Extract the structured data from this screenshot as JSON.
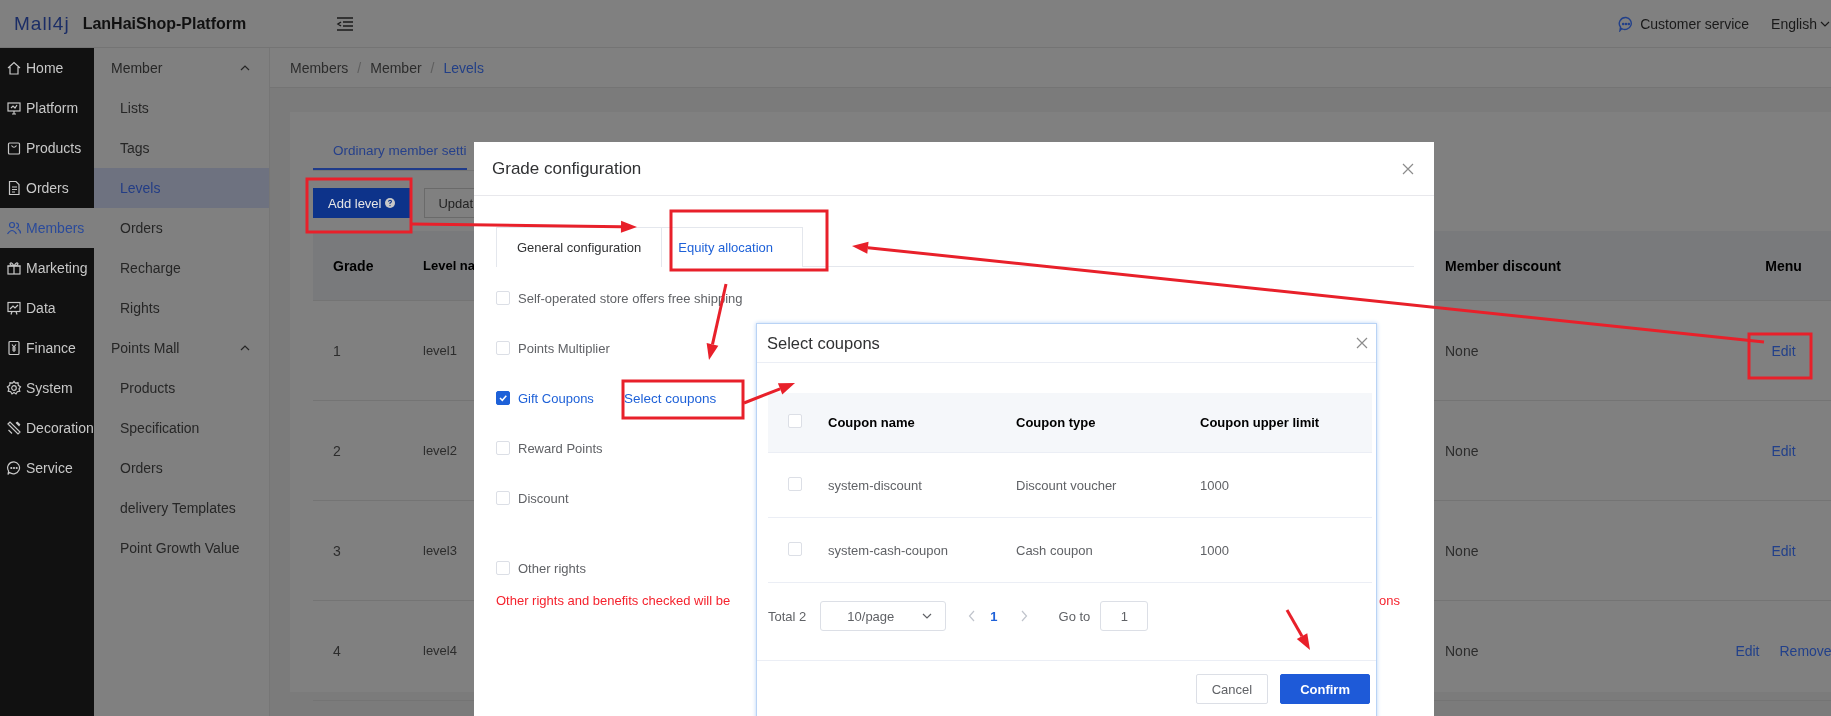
{
  "header": {
    "logo": "Mall4j",
    "title": "LanHaiShop-Platform",
    "customer_service": "Customer service",
    "language": "English"
  },
  "sidebar": {
    "items": [
      {
        "label": "Home",
        "selected": false
      },
      {
        "label": "Platform",
        "selected": false
      },
      {
        "label": "Products",
        "selected": false
      },
      {
        "label": "Orders",
        "selected": false
      },
      {
        "label": "Members",
        "selected": true
      },
      {
        "label": "Marketing",
        "selected": false
      },
      {
        "label": "Data",
        "selected": false
      },
      {
        "label": "Finance",
        "selected": false
      },
      {
        "label": "System",
        "selected": false
      },
      {
        "label": "Decoration",
        "selected": false
      },
      {
        "label": "Service",
        "selected": false
      }
    ]
  },
  "subnav": {
    "groups": [
      {
        "label": "Member",
        "expanded": true,
        "items": [
          {
            "label": "Lists",
            "selected": false
          },
          {
            "label": "Tags",
            "selected": false
          },
          {
            "label": "Levels",
            "selected": true
          },
          {
            "label": "Orders",
            "selected": false
          },
          {
            "label": "Recharge",
            "selected": false
          },
          {
            "label": "Rights",
            "selected": false
          }
        ]
      },
      {
        "label": "Points Mall",
        "expanded": true,
        "items": [
          {
            "label": "Products",
            "selected": false
          },
          {
            "label": "Specification",
            "selected": false
          },
          {
            "label": "Orders",
            "selected": false
          },
          {
            "label": "delivery Templates",
            "selected": false
          },
          {
            "label": "Point Growth Value",
            "selected": false
          }
        ]
      }
    ]
  },
  "breadcrumb": [
    {
      "label": "Members",
      "separator": "/"
    },
    {
      "label": "Member",
      "separator": "/"
    },
    {
      "label": "Levels"
    }
  ],
  "page": {
    "tabs": [
      {
        "label": "Ordinary member setti",
        "selected": true
      }
    ],
    "buttons": [
      {
        "label": "Add level",
        "kind": "primary"
      },
      {
        "label": "Updat",
        "kind": "default"
      }
    ],
    "table": {
      "columns": [
        "Grade",
        "Level na",
        "Member discount",
        "Menu"
      ],
      "rows": [
        {
          "grade": "1",
          "level_name": "level1",
          "member_discount": "None",
          "menu": [
            "Edit"
          ]
        },
        {
          "grade": "2",
          "level_name": "level2",
          "member_discount": "None",
          "menu": [
            "Edit"
          ]
        },
        {
          "grade": "3",
          "level_name": "level3",
          "member_discount": "None",
          "menu": [
            "Edit"
          ]
        },
        {
          "grade": "4",
          "level_name": "level4",
          "member_discount": "None",
          "menu": [
            "Edit",
            "Remove"
          ]
        }
      ]
    }
  },
  "grade_dialog": {
    "title": "Grade configuration",
    "tabs": [
      {
        "label": "General configuration",
        "selected": false
      },
      {
        "label": "Equity allocation",
        "selected": true
      }
    ],
    "rights": [
      {
        "label": "Self-operated store offers free shipping",
        "checked": false
      },
      {
        "label": "Points Multiplier",
        "checked": false
      },
      {
        "label": "Gift Coupons",
        "checked": true,
        "link": "Select coupons"
      },
      {
        "label": "Reward Points",
        "checked": false
      },
      {
        "label": "Discount",
        "checked": false
      },
      {
        "label": "Other rights",
        "checked": false
      }
    ],
    "note": "Other rights and benefits checked will be",
    "note_tail": "ons"
  },
  "coupon_dialog": {
    "title": "Select coupons",
    "header_checked": false,
    "columns": [
      "Coupon name",
      "Coupon type",
      "Coupon upper limit"
    ],
    "rows": [
      {
        "checked": false,
        "cells": [
          "system-discount",
          "Discount voucher",
          "1000"
        ]
      },
      {
        "checked": false,
        "cells": [
          "system-cash-coupon",
          "Cash coupon",
          "1000"
        ]
      }
    ],
    "pagination": {
      "total": "Total 2",
      "page_size": "10/page",
      "pages": [
        {
          "label": "1",
          "selected": true
        }
      ],
      "goto_label": "Go to",
      "goto_value": "1"
    },
    "buttons": [
      {
        "label": "Cancel",
        "kind": "default"
      },
      {
        "label": "Confirm",
        "kind": "primary"
      }
    ]
  }
}
